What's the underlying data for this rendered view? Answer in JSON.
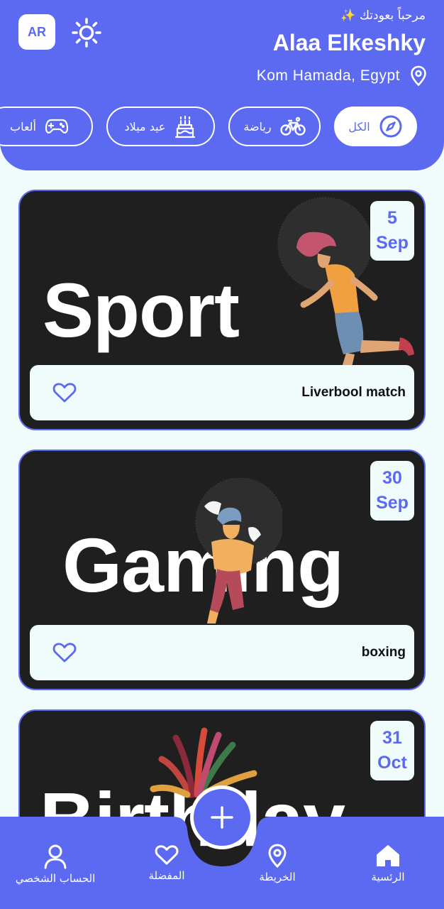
{
  "header": {
    "lang_button": "AR",
    "greeting": "مرحباً بعودتك ✨",
    "user_name": "Alaa Elkeshky",
    "location": "Kom Hamada, Egypt",
    "accent_color": "#5b6af0"
  },
  "categories": [
    {
      "label": "الكل",
      "icon": "compass-icon",
      "active": true
    },
    {
      "label": "رياضة",
      "icon": "bicycle-icon",
      "active": false
    },
    {
      "label": "عيد ميلاد",
      "icon": "birthday-cake-icon",
      "active": false
    },
    {
      "label": "ألعاب",
      "icon": "gamepad-icon",
      "active": false
    }
  ],
  "events": [
    {
      "banner_word": "Sport",
      "day": "5",
      "month": "Sep",
      "title": "Liverbool match",
      "favorite": false
    },
    {
      "banner_word": "Gaming",
      "day": "30",
      "month": "Sep",
      "title": "boxing",
      "favorite": false
    },
    {
      "banner_word": "Birthday",
      "day": "31",
      "month": "Oct",
      "title": "",
      "favorite": false
    }
  ],
  "bottom_nav": {
    "home": "الرئسية",
    "map": "الخريطة",
    "favorites": "المفضلة",
    "profile": "الحساب الشخصي",
    "add_icon": "plus-icon"
  }
}
